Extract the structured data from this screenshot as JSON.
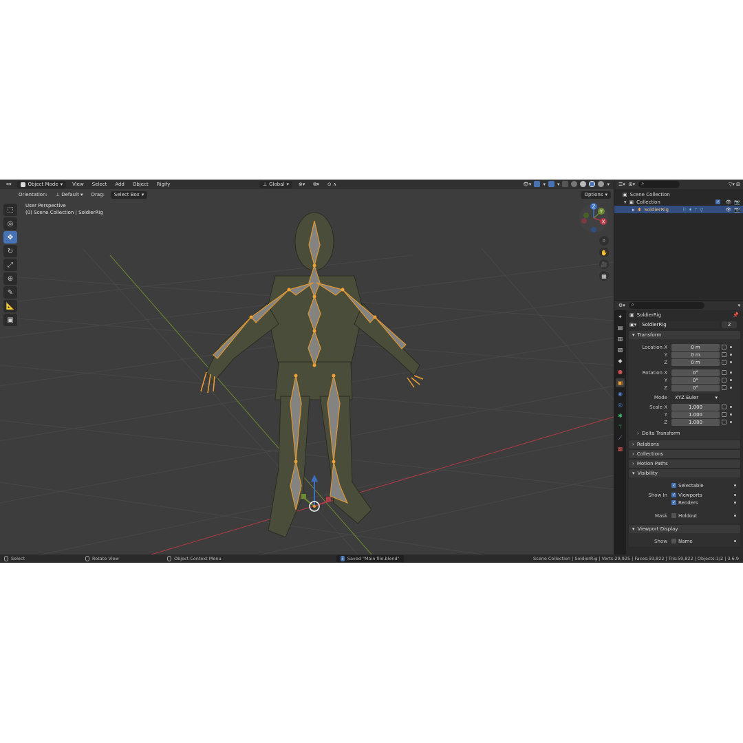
{
  "viewport": {
    "header": {
      "mode": "Object Mode",
      "menus": [
        "View",
        "Select",
        "Add",
        "Object",
        "Rigify"
      ],
      "transform_orientation": "Global"
    },
    "tool_settings": {
      "orientation_label": "Orientation:",
      "orientation_value": "Default",
      "drag_label": "Drag:",
      "drag_value": "Select Box",
      "options_label": "Options"
    },
    "overlay_line1": "User Perspective",
    "overlay_line2": "(0) Scene Collection | SoldierRig",
    "gizmo_axes": [
      "Z",
      "Y",
      "X"
    ],
    "colors": {
      "background": "#3d3d3d",
      "x_axis": "#b13a45",
      "y_axis": "#6b8a2e",
      "z_axis": "#3b6fc4",
      "selection": "#f0a030"
    }
  },
  "outliner": {
    "root": "Scene Collection",
    "collection": "Collection",
    "object": "SoldierRig"
  },
  "properties": {
    "object_name_header": "SoldierRig",
    "object_name_field": "SoldierRig",
    "users_count": "2",
    "transform_label": "Transform",
    "location": {
      "label_x": "Location X",
      "x": "0 m",
      "y": "0 m",
      "z": "0 m"
    },
    "rotation": {
      "label_x": "Rotation X",
      "x": "0°",
      "y": "0°",
      "z": "0°"
    },
    "mode_label": "Mode",
    "mode_value": "XYZ Euler",
    "scale": {
      "label_x": "Scale X",
      "x": "1.000",
      "y": "1.000",
      "z": "1.000"
    },
    "axis_y": "Y",
    "axis_z": "Z",
    "delta_transform": "Delta Transform",
    "relations": "Relations",
    "collections": "Collections",
    "motion_paths": "Motion Paths",
    "visibility": "Visibility",
    "selectable": "Selectable",
    "show_in_label": "Show In",
    "viewports": "Viewports",
    "renders": "Renders",
    "mask_label": "Mask",
    "holdout": "Holdout",
    "viewport_display": "Viewport Display",
    "show_label": "Show",
    "name": "Name"
  },
  "statusbar": {
    "select": "Select",
    "rotate_view": "Rotate View",
    "context_menu": "Object Context Menu",
    "saved_message": "Saved \"Main file.blend\"",
    "stats": "Scene Collection | SoldierRig | Verts:29,925 | Faces:59,822 | Tris:59,822 | Objects:1/2 | 3.6.9"
  }
}
